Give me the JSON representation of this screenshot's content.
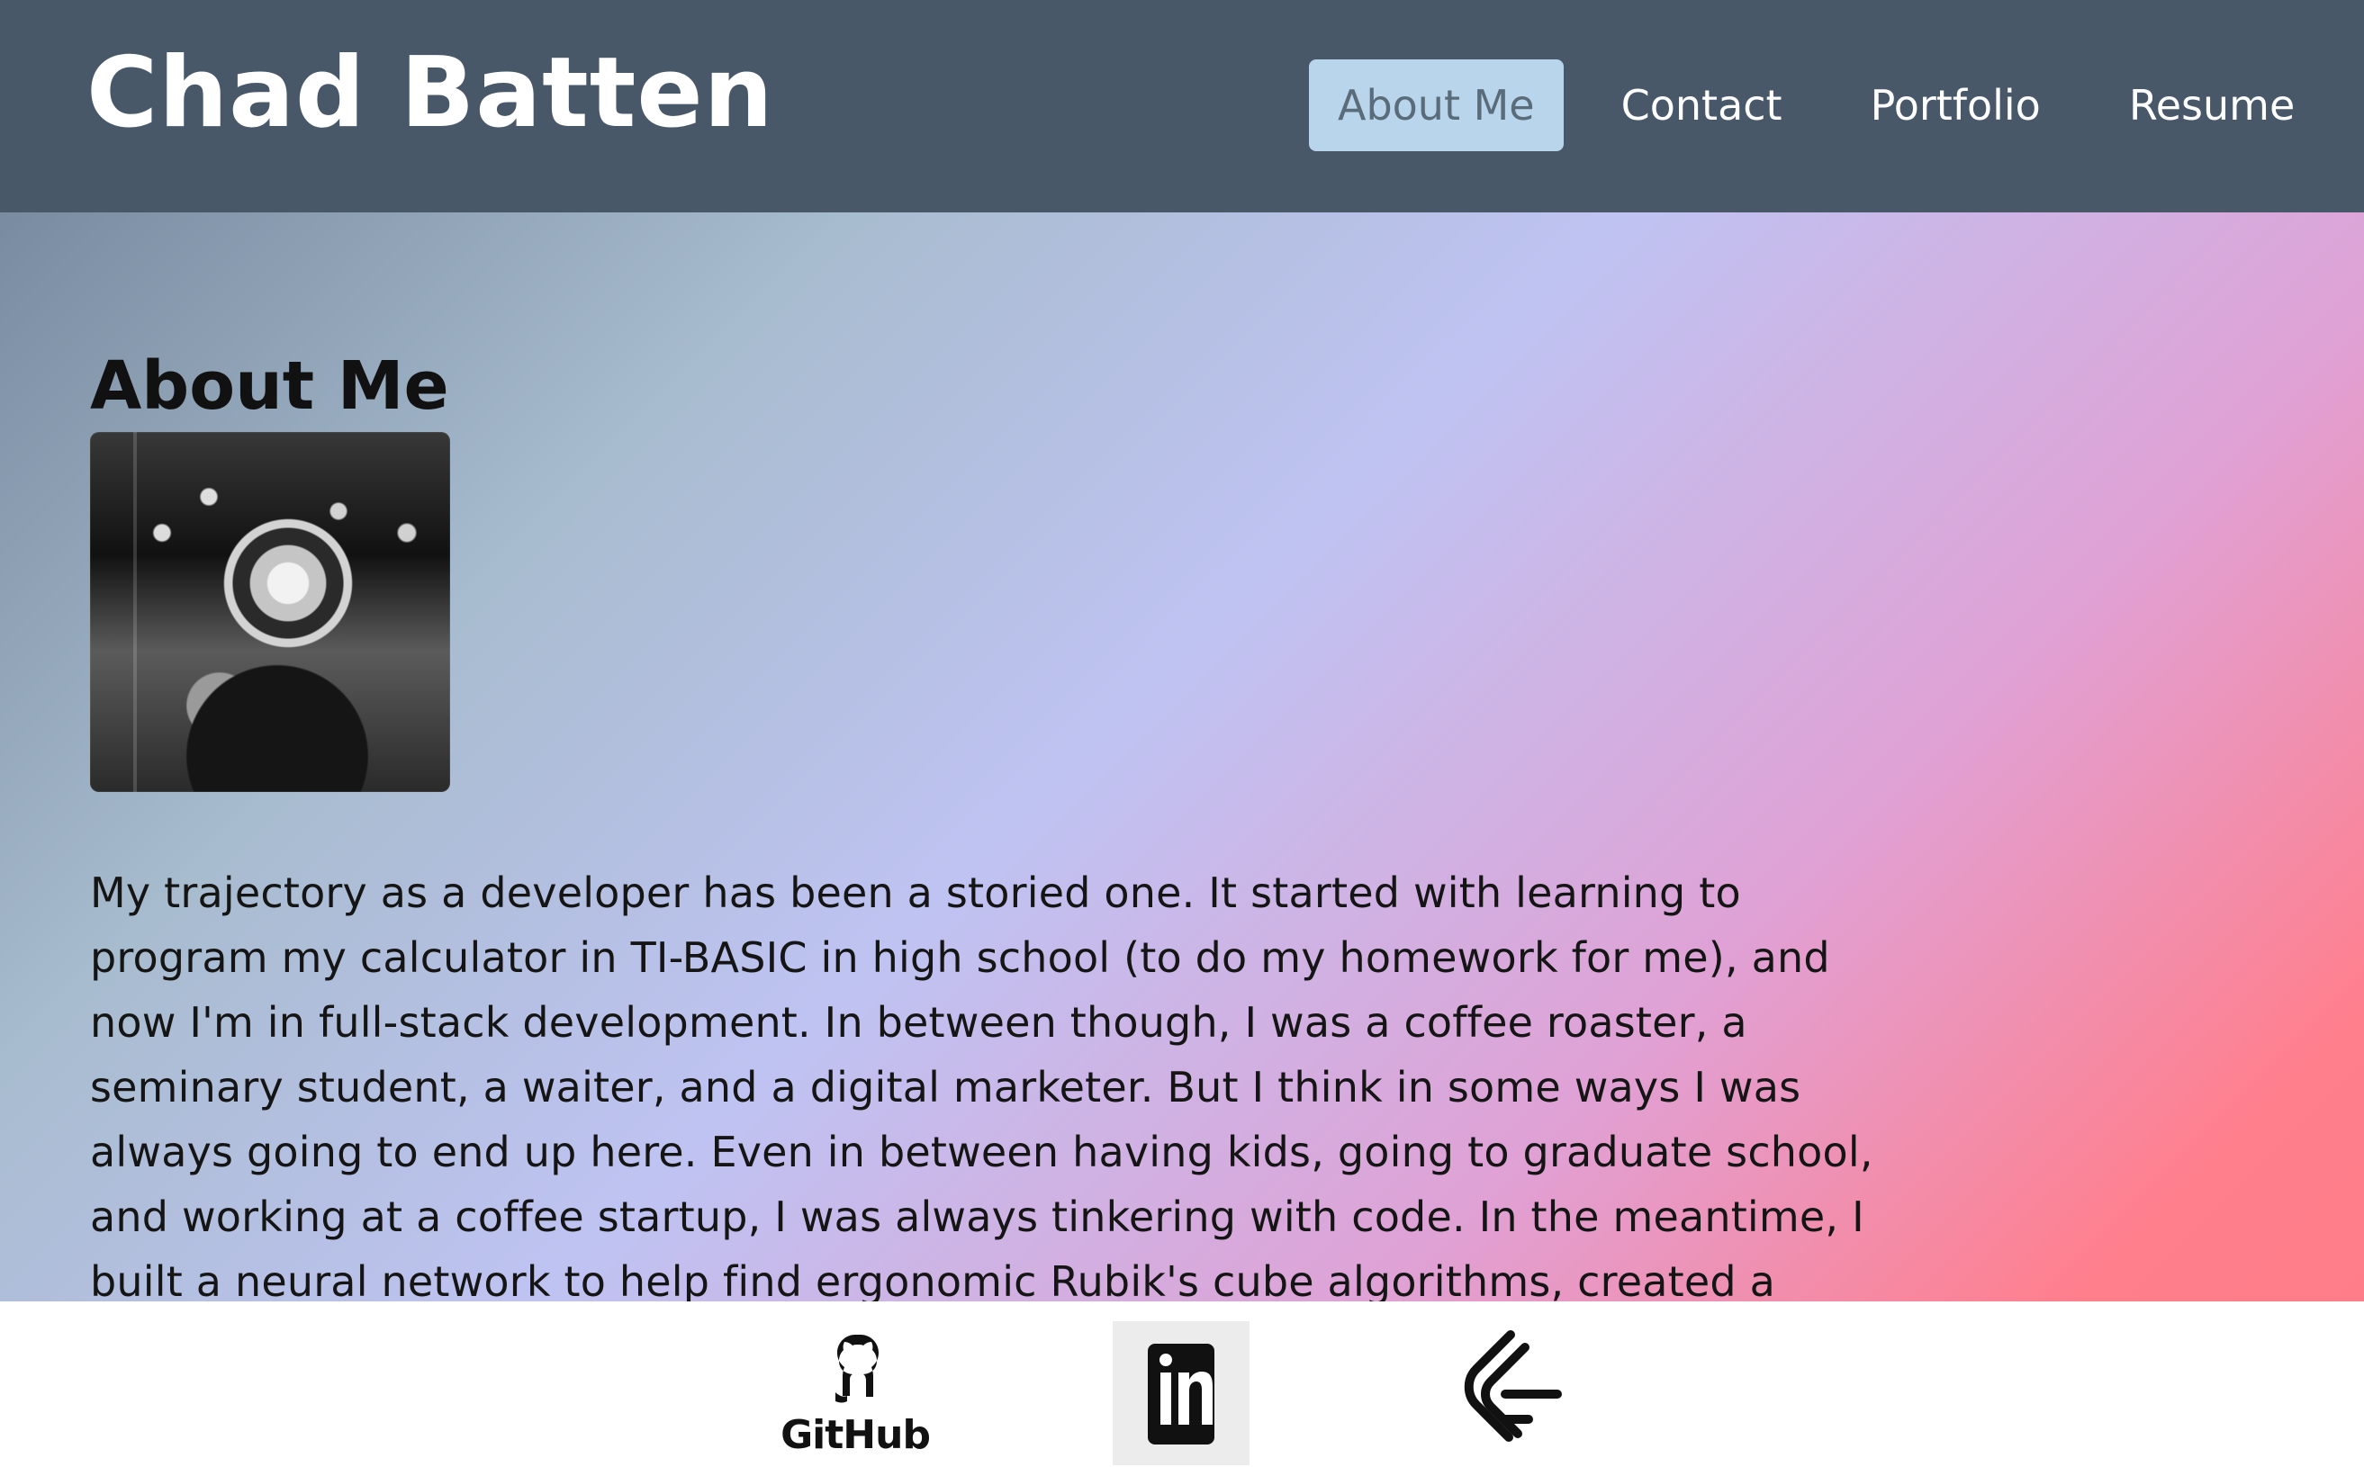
{
  "header": {
    "brand": "Chad Batten",
    "nav": [
      {
        "label": "About Me",
        "active": true
      },
      {
        "label": "Contact",
        "active": false
      },
      {
        "label": "Portfolio",
        "active": false
      },
      {
        "label": "Resume",
        "active": false
      }
    ]
  },
  "main": {
    "title": "About Me",
    "bio": "My trajectory as a developer has been a storied one. It started with learning to program my calculator in TI-BASIC in high school (to do my homework for me), and now I'm in full-stack development. In between though, I was a coffee roaster, a seminary student, a waiter, and a digital marketer. But I think in some ways I was always going to end up here. Even in between having kids, going to graduate school, and working at a coffee startup, I was always tinkering with code. In the meantime, I built a neural network to help find ergonomic Rubik's cube algorithms, created a Chrome extension to automate my marketing job, and built Shopify API connections in Python to help automate a small business. And now -- I plan on coding every day!"
  },
  "footer": {
    "links": [
      {
        "label": "GitHub",
        "icon": "github-icon"
      },
      {
        "label": "LinkedIn",
        "icon": "linkedin-icon"
      },
      {
        "label": "CodePen",
        "icon": "codepen-icon"
      }
    ]
  }
}
